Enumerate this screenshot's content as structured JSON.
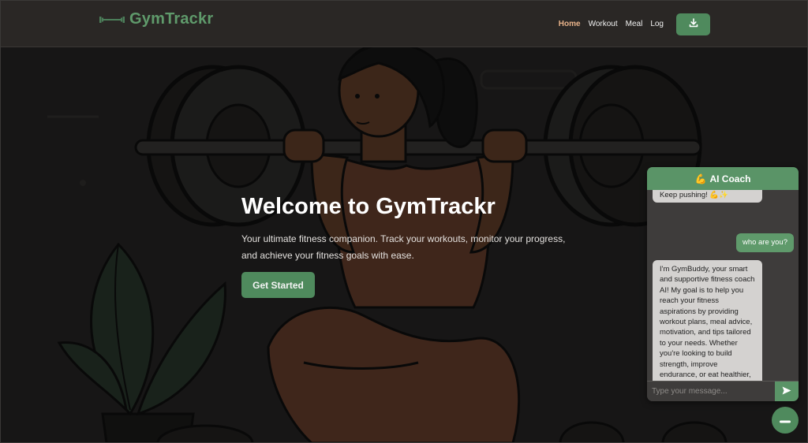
{
  "header": {
    "brand": "GymTrackr",
    "nav": [
      {
        "label": "Home",
        "active": true
      },
      {
        "label": "Workout",
        "active": false
      },
      {
        "label": "Meal",
        "active": false
      },
      {
        "label": "Log",
        "active": false
      }
    ],
    "download_icon": "download-icon",
    "logo_icon": "dumbbell-icon"
  },
  "hero": {
    "title": "Welcome to GymTrackr",
    "text": "Your ultimate fitness companion. Track your workouts, monitor your progress, and achieve your fitness goals with ease.",
    "cta": "Get Started"
  },
  "chat": {
    "header_emoji": "💪",
    "header_title": "AI Coach",
    "messages": [
      {
        "role": "bot",
        "text": "Keep pushing! 💪✨"
      },
      {
        "role": "user",
        "text": "who are you?"
      },
      {
        "role": "bot",
        "text": "I'm GymBuddy, your smart and supportive fitness coach AI! My goal is to help you reach your fitness aspirations by providing workout plans, meal advice, motivation, and tips tailored to your needs. Whether you're looking to build strength, improve endurance, or eat healthier, I'm here to support you every step of the way. What can I assist you with today? 💪😊"
      }
    ],
    "input_placeholder": "Type your message...",
    "send_icon": "send-icon",
    "toggle_icon": "minus-icon"
  },
  "colors": {
    "accent": "#5f9a6b",
    "nav_active": "#e9b38a",
    "header_bg": "#2a2725",
    "page_bg": "#1b1a19"
  }
}
